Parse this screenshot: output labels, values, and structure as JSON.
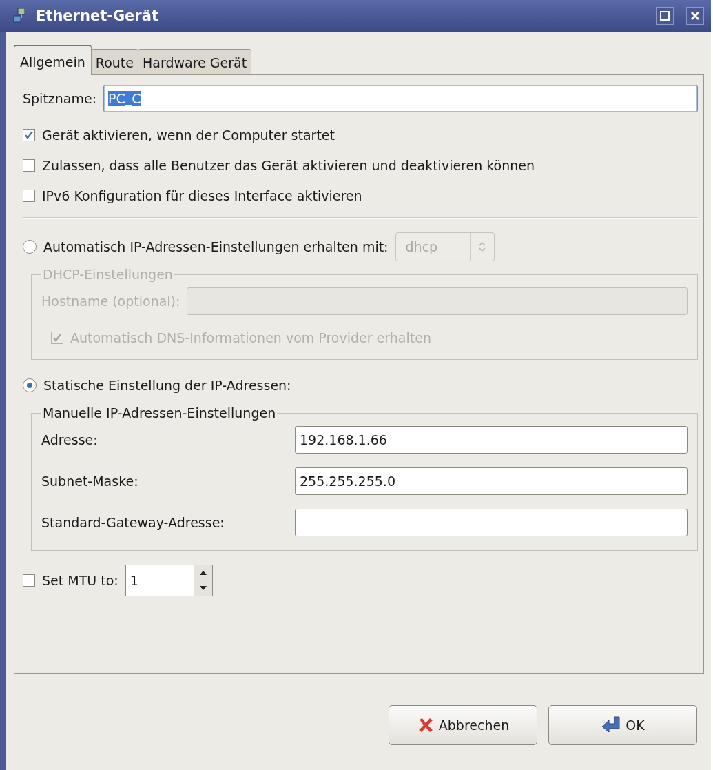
{
  "window": {
    "title": "Ethernet-Gerät"
  },
  "tabs": [
    {
      "label": "Allgemein",
      "selected": true
    },
    {
      "label": "Route",
      "selected": false
    },
    {
      "label": "Hardware Gerät",
      "selected": false
    }
  ],
  "nickname": {
    "label": "Spitzname:",
    "value": "PC_C",
    "text_selected": true
  },
  "checkboxes": [
    {
      "label": "Gerät aktivieren, wenn der Computer startet",
      "checked": true
    },
    {
      "label": "Zulassen, dass alle Benutzer das Gerät aktivieren und deaktivieren können",
      "checked": false
    },
    {
      "label": "IPv6 Konfiguration für dieses Interface aktivieren",
      "checked": false
    }
  ],
  "auto_radio": {
    "label": "Automatisch IP-Adressen-Einstellungen erhalten mit:",
    "selected": false,
    "dropdown": {
      "value": "dhcp",
      "disabled": true
    }
  },
  "dhcp_group": {
    "title": "DHCP-Einstellungen",
    "disabled": true,
    "hostname": {
      "label": "Hostname (optional):"
    },
    "dns": {
      "label": "Automatisch DNS-Informationen vom Provider erhalten",
      "checked": true
    }
  },
  "static_radio": {
    "label": "Statische Einstellung der IP-Adressen:",
    "selected": true
  },
  "manual_group": {
    "title": "Manuelle IP-Adressen-Einstellungen",
    "fields": [
      {
        "label": "Adresse:",
        "value": "192.168.1.66"
      },
      {
        "label": "Subnet-Maske:",
        "value": "255.255.255.0"
      },
      {
        "label": "Standard-Gateway-Adresse:"
      }
    ]
  },
  "mtu": {
    "label": "Set MTU to:",
    "checked": false,
    "value": "1"
  },
  "buttons": [
    {
      "label": "Abbrechen",
      "kind": "cancel"
    },
    {
      "label": "OK",
      "kind": "ok"
    }
  ]
}
